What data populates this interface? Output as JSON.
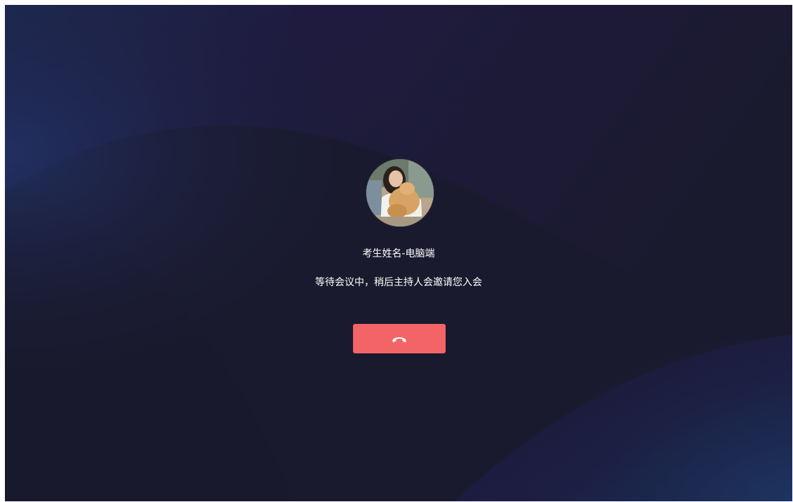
{
  "participant": {
    "name": "考生姓名-电脑端",
    "avatar": "participant-photo"
  },
  "status": {
    "message": "等待会议中，稍后主持人会邀请您入会"
  },
  "controls": {
    "hangup_icon": "phone-hangup-icon"
  },
  "colors": {
    "background": "#1a1a2e",
    "hangup_button": "#f26466"
  }
}
